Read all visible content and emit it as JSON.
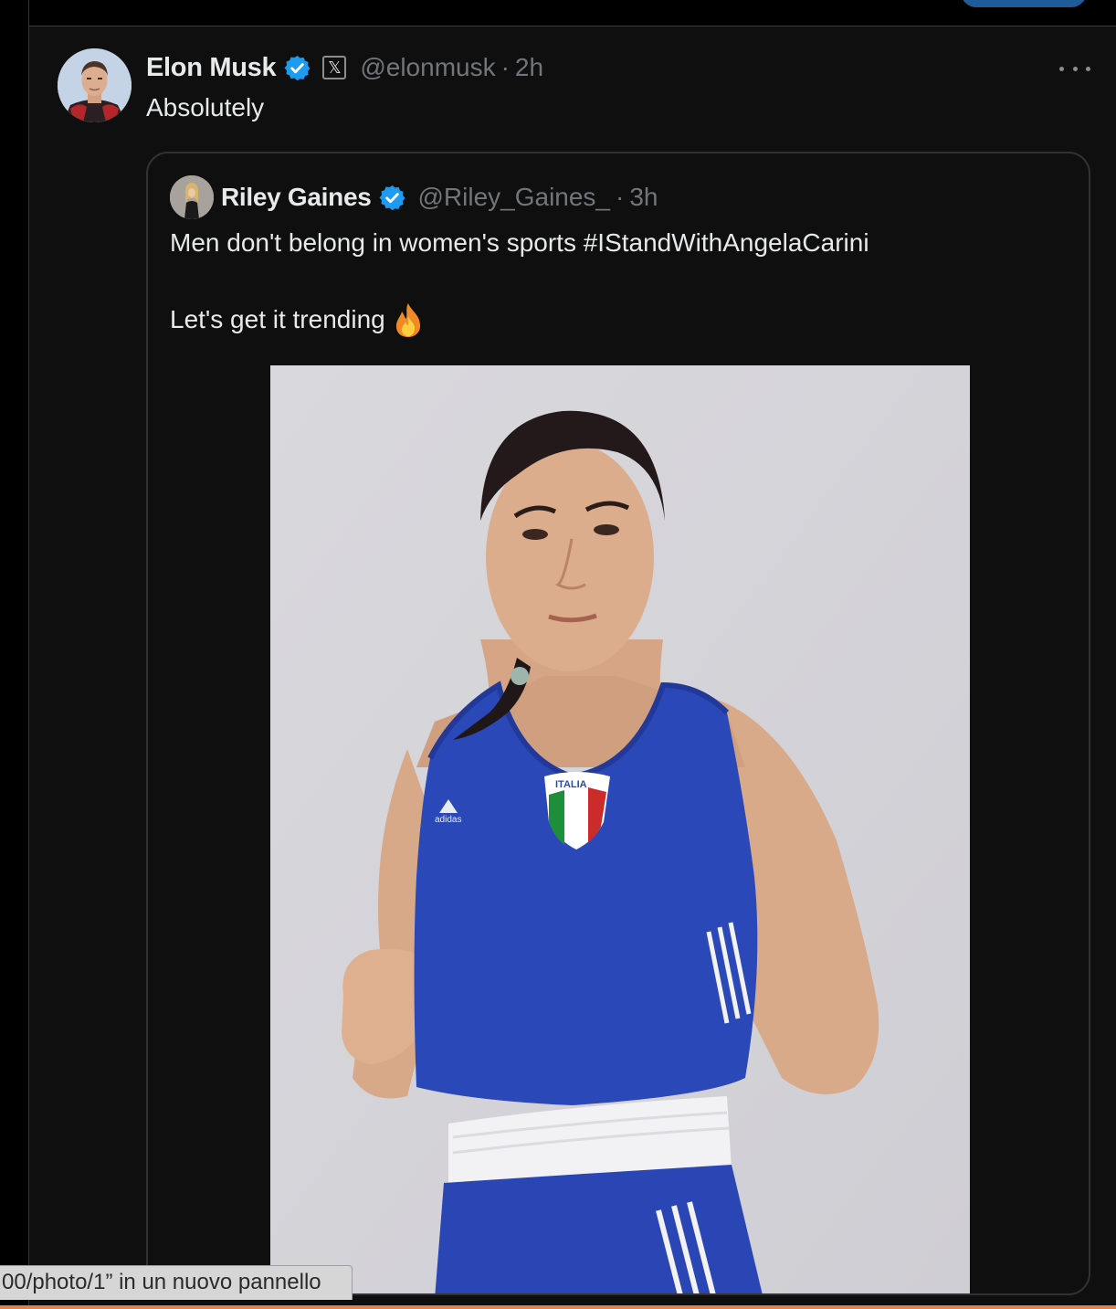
{
  "post": {
    "author_name": "Elon Musk",
    "author_handle": "@elonmusk",
    "separator": "·",
    "time": "2h",
    "affiliate_badge": "𝕏",
    "text": "Absolutely",
    "more_icon": "more-dots-icon"
  },
  "quoted_post": {
    "author_name": "Riley Gaines",
    "author_handle": "@Riley_Gaines_",
    "separator": "·",
    "time": "3h",
    "line1": "Men don't belong in women's sports #IStandWithAngelaCarini",
    "line2": "Let's get it trending",
    "emoji_icon": "fire-icon",
    "media": {
      "type": "photo",
      "jersey_text": "ITALIA",
      "brand_text": "adidas"
    }
  },
  "status_bar": {
    "link_text": "00/photo/1” in un nuovo pannello"
  },
  "colors": {
    "background": "#0f0f0f",
    "text_primary": "#e7e9ea",
    "text_secondary": "#71767b",
    "verified_blue": "#1d9bf0",
    "border": "#2f3336"
  }
}
